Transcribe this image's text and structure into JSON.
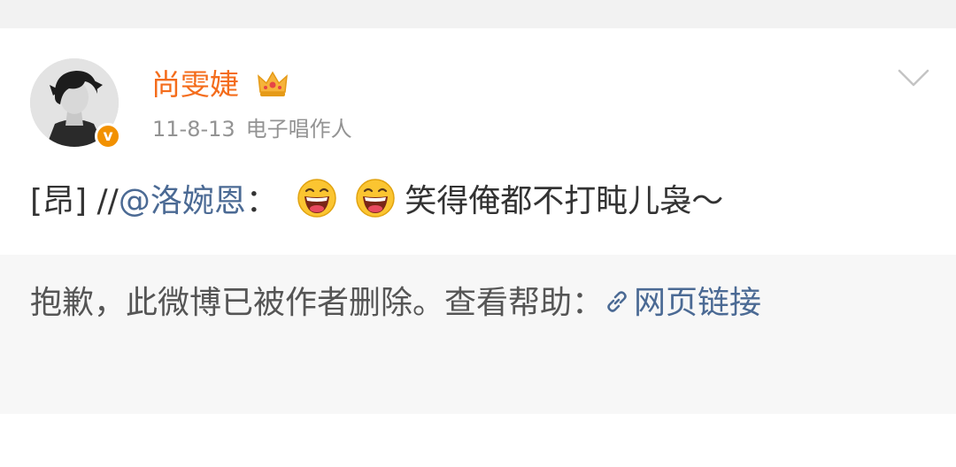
{
  "post": {
    "username": "尚雯婕",
    "date": "11-8-13",
    "source": "电子唱作人",
    "content": {
      "prefix": "[昂]",
      "slashes": "//",
      "mention": "@洛婉恩",
      "colon": "：",
      "text": "笑得俺都不打盹儿袅～"
    }
  },
  "repost": {
    "deleted_message": "抱歉，此微博已被作者删除。查看帮助：",
    "help_link_label": "网页链接"
  },
  "colors": {
    "username": "#f46c1b",
    "link": "#4b6a94",
    "verified_badge": "#f29100"
  },
  "icons": {
    "verified": "verified-v-badge",
    "vip": "crown-icon",
    "menu": "chevron-down-icon",
    "link": "link-icon",
    "emoji": "laughing-face-emoji"
  }
}
